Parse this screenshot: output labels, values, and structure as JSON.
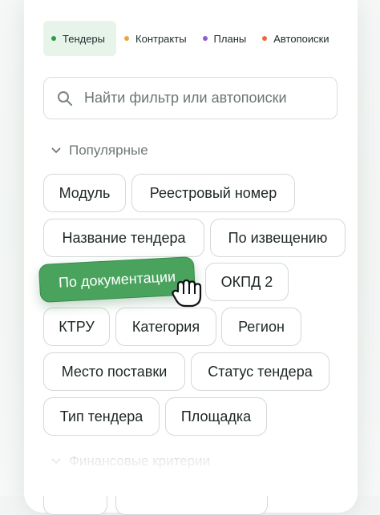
{
  "tabs": [
    {
      "label": "Тендеры",
      "color": "#2e9a4a",
      "active": true
    },
    {
      "label": "Контракты",
      "color": "#f2a23a",
      "active": false
    },
    {
      "label": "Планы",
      "color": "#8e5bd8",
      "active": false
    },
    {
      "label": "Автопоиски",
      "color": "#ec6a3b",
      "active": false
    }
  ],
  "search": {
    "placeholder": "Найти фильтр или автопоиски",
    "icon": "search-icon"
  },
  "sections": {
    "popular": "Популярные",
    "financial": "Финансовые критерии"
  },
  "chips": [
    "Модуль",
    "Реестровый номер",
    "Название тендера",
    "По извещению",
    "По документации",
    "ОКПД 2",
    "КТРУ",
    "Категория",
    "Регион",
    "Место поставки",
    "Статус тендера",
    "Тип тендера",
    "Площадка"
  ],
  "dragged_chip_color": "#49a35d",
  "cursor": "grab-hand-icon"
}
